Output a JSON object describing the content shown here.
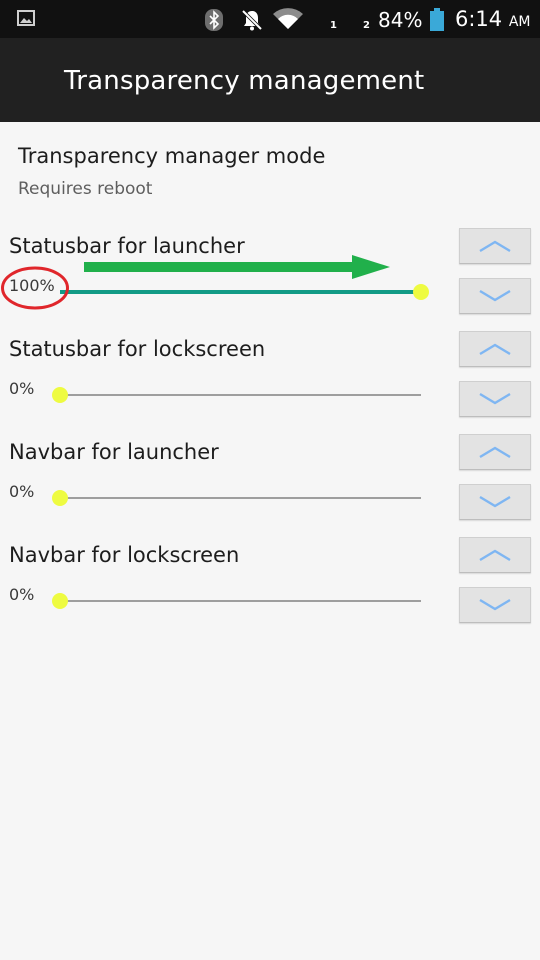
{
  "status_bar": {
    "battery_percent": "84%",
    "time": "6:14",
    "ampm": "AM",
    "sim1": "1",
    "sim2": "2",
    "icons": [
      "gallery-icon",
      "bluetooth-icon",
      "notifications-off-icon",
      "wifi-icon",
      "battery-icon"
    ]
  },
  "app_bar": {
    "title": "Transparency management"
  },
  "mode_pref": {
    "title": "Transparency manager mode",
    "summary": "Requires reboot"
  },
  "sliders": [
    {
      "title": "Statusbar for launcher",
      "value": "100%",
      "level": 1.0
    },
    {
      "title": "Statusbar for lockscreen",
      "value": "0%",
      "level": 0.0
    },
    {
      "title": "Navbar for launcher",
      "value": "0%",
      "level": 0.0
    },
    {
      "title": "Navbar for lockscreen",
      "value": "0%",
      "level": 0.0
    }
  ],
  "colors": {
    "accent_track": "#129b86",
    "thumb": "#eefb41",
    "annotation_red": "#e0262b",
    "annotation_green": "#21b04b",
    "chevron": "#7fb6f2"
  }
}
